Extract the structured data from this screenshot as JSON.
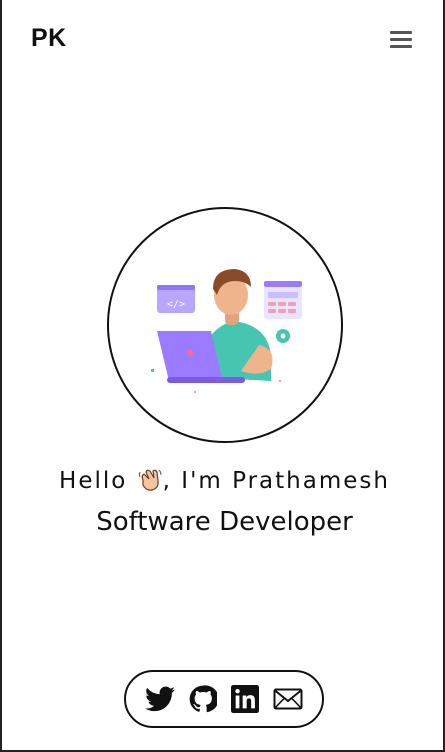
{
  "header": {
    "brand": "PK",
    "menu_icon": "hamburger-icon"
  },
  "hero": {
    "greeting_prefix": "Hello",
    "wave_icon": "waving-hand-icon",
    "greeting_suffix": ", I'm Prathamesh",
    "role": "Software Developer",
    "illustration": "developer-laptop-illustration"
  },
  "socials": {
    "items": [
      {
        "icon": "twitter-icon"
      },
      {
        "icon": "github-icon"
      },
      {
        "icon": "linkedin-icon"
      },
      {
        "icon": "mail-icon"
      }
    ]
  },
  "colors": {
    "text": "#111111",
    "border": "#222222",
    "accent_purple": "#9b7bff",
    "accent_teal": "#46c6b1"
  }
}
